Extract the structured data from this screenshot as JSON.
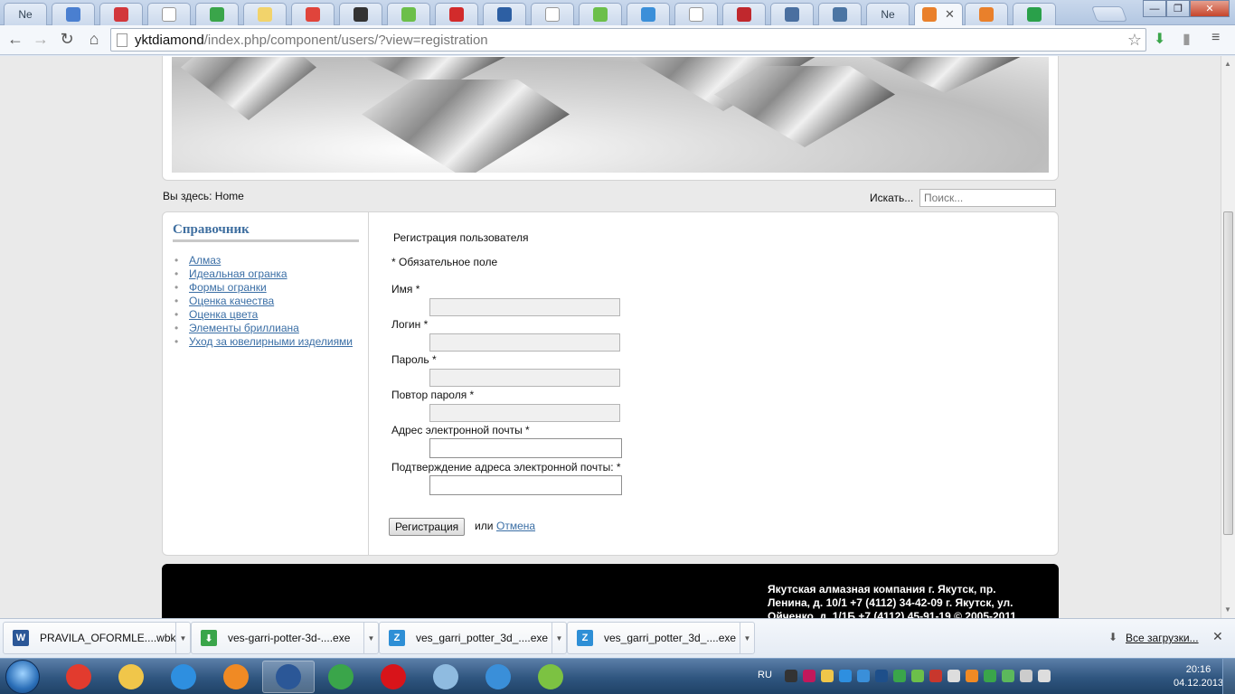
{
  "browser": {
    "tabs": [
      {
        "label": "Ne",
        "icon": "letter-icon",
        "color": ""
      },
      {
        "label": "",
        "icon": "blue-circle-icon",
        "color": "#4a7fd0"
      },
      {
        "label": "",
        "icon": "target-icon",
        "color": "#d2373c"
      },
      {
        "label": "",
        "icon": "page-icon",
        "color": "#ffffff"
      },
      {
        "label": "",
        "icon": "windows-icon",
        "color": "#3aa54a"
      },
      {
        "label": "",
        "icon": "envelope-icon",
        "color": "#f2d36b"
      },
      {
        "label": "",
        "icon": "yandex-icon",
        "color": "#e0443b"
      },
      {
        "label": "",
        "icon": "graduation-cap-icon",
        "color": "#333333"
      },
      {
        "label": "",
        "icon": "green-check-icon",
        "color": "#6cbf4a"
      },
      {
        "label": "",
        "icon": "red-x-icon",
        "color": "#d22b2b"
      },
      {
        "label": "",
        "icon": "r-letter-icon",
        "color": "#2d5fa3"
      },
      {
        "label": "",
        "icon": "page-icon",
        "color": "#ffffff"
      },
      {
        "label": "",
        "icon": "green-check-icon",
        "color": "#6cbf4a"
      },
      {
        "label": "",
        "icon": "v-circle-icon",
        "color": "#3b8fd9"
      },
      {
        "label": "",
        "icon": "page-icon",
        "color": "#ffffff"
      },
      {
        "label": "",
        "icon": "grid-icon",
        "color": "#c0282d"
      },
      {
        "label": "",
        "icon": "play-icon",
        "color": "#4a6fa0"
      },
      {
        "label": "",
        "icon": "vk-icon",
        "color": "#4c75a3"
      },
      {
        "label": "Ne",
        "icon": "letter-icon",
        "color": ""
      },
      {
        "label": "",
        "icon": "joomla-icon",
        "color": "#e9802b",
        "active": true
      },
      {
        "label": "",
        "icon": "joomla-icon",
        "color": "#e9802b"
      },
      {
        "label": "",
        "icon": "download-arrow-icon",
        "color": "#2aa04a"
      }
    ],
    "active_tab_close": "✕",
    "window_buttons": {
      "minimize": "—",
      "maximize": "❐",
      "close": "✕"
    },
    "url_host": "yktdiamond",
    "url_path": "/index.php/component/users/?view=registration"
  },
  "page": {
    "breadcrumb": "Вы здесь: Home",
    "search_label": "Искать...",
    "search_placeholder": "Поиск...",
    "sidebar": {
      "title": "Справочник",
      "items": [
        "Алмаз",
        "Идеальная огранка",
        "Формы огранки",
        "Оценка качества",
        "Оценка цвета",
        "Элементы бриллиана",
        "Уход за ювелирными изделиями"
      ]
    },
    "form": {
      "title": "Регистрация пользователя",
      "required_note": "* Обязательное поле",
      "fields": [
        {
          "label": "Имя *",
          "value": ""
        },
        {
          "label": "Логин *",
          "value": ""
        },
        {
          "label": "Пароль *",
          "value": ""
        },
        {
          "label": "Повтор пароля *",
          "value": ""
        },
        {
          "label": "Адрес электронной почты *",
          "value": ""
        },
        {
          "label": "Подтверждение адреса электронной почты: *",
          "value": ""
        }
      ],
      "submit_label": "Регистрация",
      "or_text": "или",
      "cancel_label": "Отмена"
    },
    "footer": {
      "text": "Якутская алмазная компания г. Якутск, пр. Ленина, д. 10/1 +7 (4112) 34-42-09 г. Якутск, ул. Ойченко, д. 1/1Б +7 (4112) 45-91-19 © 2005-2011"
    }
  },
  "downloads": {
    "items": [
      {
        "name": "PRAVILA_OFORMLE....wbk",
        "icon": "word-doc-icon",
        "color": "#2b5797"
      },
      {
        "name": "ves-garri-potter-3d-....exe",
        "icon": "download-arrow-icon",
        "color": "#3aa54a"
      },
      {
        "name": "ves_garri_potter_3d_....exe",
        "icon": "installer-icon",
        "color": "#2e8fd6"
      },
      {
        "name": "ves_garri_potter_3d_....exe",
        "icon": "installer-icon",
        "color": "#2e8fd6"
      }
    ],
    "show_all": "Все загрузки...",
    "close": "✕"
  },
  "taskbar": {
    "apps": [
      {
        "name": "chrome-red-icon",
        "color": "#e23b2e"
      },
      {
        "name": "explorer-folder-icon",
        "color": "#f0c64a"
      },
      {
        "name": "internet-explorer-icon",
        "color": "#2e8fe0"
      },
      {
        "name": "media-player-icon",
        "color": "#f08a24"
      },
      {
        "name": "word-icon",
        "color": "#2b5797",
        "active": true
      },
      {
        "name": "chrome-icon",
        "color": "#3aa54a"
      },
      {
        "name": "opera-icon",
        "color": "#d8141a"
      },
      {
        "name": "notepad-icon",
        "color": "#8fbbe0"
      },
      {
        "name": "sync-icon",
        "color": "#3a8fd9"
      },
      {
        "name": "pie-app-icon",
        "color": "#7cc242"
      }
    ],
    "language": "RU",
    "time": "20:16",
    "date": "04.12.2013"
  }
}
